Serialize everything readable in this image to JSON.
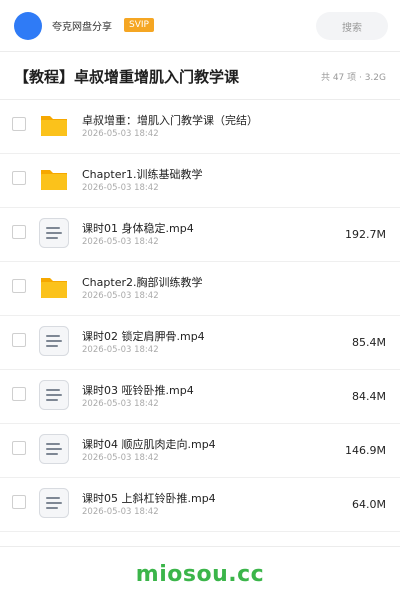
{
  "header": {
    "sharer_name": "夸克网盘分享",
    "badge": "SVIP",
    "search_label": "搜索"
  },
  "title_bar": {
    "title": "【教程】卓叔增重增肌入门教学课",
    "summary": "共 47 项 · 3.2G"
  },
  "files": [
    {
      "type": "folder",
      "name": "卓叔增重：增肌入门教学课（完结）",
      "date": "2026-05-03 18:42",
      "size": ""
    },
    {
      "type": "folder",
      "name": "Chapter1.训练基础教学",
      "date": "2026-05-03 18:42",
      "size": ""
    },
    {
      "type": "file",
      "name": "课时01 身体稳定.mp4",
      "date": "2026-05-03 18:42",
      "size": "192.7M"
    },
    {
      "type": "folder",
      "name": "Chapter2.胸部训练教学",
      "date": "2026-05-03 18:42",
      "size": ""
    },
    {
      "type": "file",
      "name": "课时02 锁定肩胛骨.mp4",
      "date": "2026-05-03 18:42",
      "size": "85.4M"
    },
    {
      "type": "file",
      "name": "课时03 哑铃卧推.mp4",
      "date": "2026-05-03 18:42",
      "size": "84.4M"
    },
    {
      "type": "file",
      "name": "课时04 顺应肌肉走向.mp4",
      "date": "2026-05-03 18:42",
      "size": "146.9M"
    },
    {
      "type": "file",
      "name": "课时05 上斜杠铃卧推.mp4",
      "date": "2026-05-03 18:42",
      "size": "64.0M"
    }
  ],
  "icons": {
    "folder": "folder-icon",
    "file": "document-icon"
  },
  "colors": {
    "avatar": "#2f7bf6",
    "badge": "#f5a623",
    "folder": "#fbc21b",
    "watermark": "#3bb54a"
  },
  "watermark": "miosou.cc"
}
